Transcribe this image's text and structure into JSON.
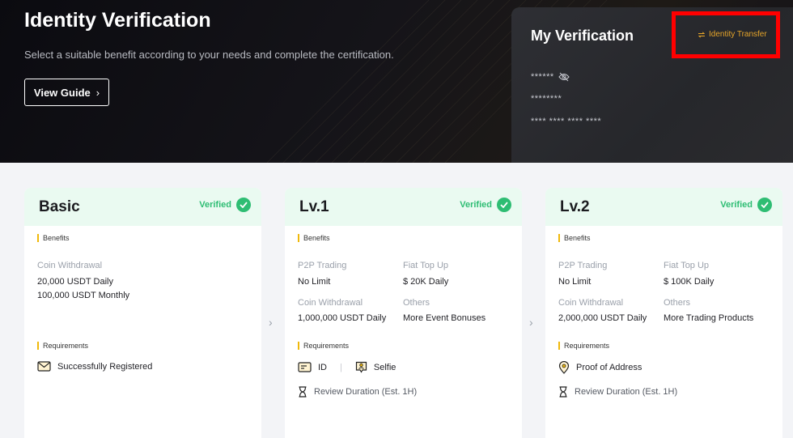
{
  "hero": {
    "title": "Identity Verification",
    "subtitle": "Select a suitable benefit according to your needs and complete the certification.",
    "guide_button": "View Guide"
  },
  "my_verification": {
    "title": "My Verification",
    "transfer_link": "Identity Transfer",
    "masked_name": "******",
    "masked_id": "********",
    "masked_number": "**** **** **** ****"
  },
  "cards": [
    {
      "title": "Basic",
      "status": "Verified",
      "benefits_label": "Benefits",
      "benefits": [
        {
          "key": "Coin Withdrawal",
          "values": [
            "20,000 USDT Daily",
            "100,000 USDT Monthly"
          ]
        }
      ],
      "requirements_label": "Requirements",
      "requirements": [
        "Successfully Registered"
      ]
    },
    {
      "title": "Lv.1",
      "status": "Verified",
      "benefits_label": "Benefits",
      "benefits": [
        {
          "key": "P2P Trading",
          "value": "No Limit"
        },
        {
          "key": "Fiat Top Up",
          "value": "$ 20K Daily"
        },
        {
          "key": "Coin Withdrawal",
          "value": "1,000,000 USDT Daily"
        },
        {
          "key": "Others",
          "value": "More Event Bonuses"
        }
      ],
      "requirements_label": "Requirements",
      "requirements": [
        "ID",
        "Selfie"
      ],
      "review": "Review Duration (Est. 1H)"
    },
    {
      "title": "Lv.2",
      "status": "Verified",
      "benefits_label": "Benefits",
      "benefits": [
        {
          "key": "P2P Trading",
          "value": "No Limit"
        },
        {
          "key": "Fiat Top Up",
          "value": "$ 100K Daily"
        },
        {
          "key": "Coin Withdrawal",
          "value": "2,000,000 USDT Daily"
        },
        {
          "key": "Others",
          "value": "More Trading Products"
        }
      ],
      "requirements_label": "Requirements",
      "requirements": [
        "Proof of Address"
      ],
      "review": "Review Duration (Est. 1H)"
    }
  ],
  "colors": {
    "accent_gold": "#f0b90b",
    "verified_green": "#2ebd73",
    "transfer_orange": "#e6a52a",
    "highlight_red": "#ff0000"
  }
}
